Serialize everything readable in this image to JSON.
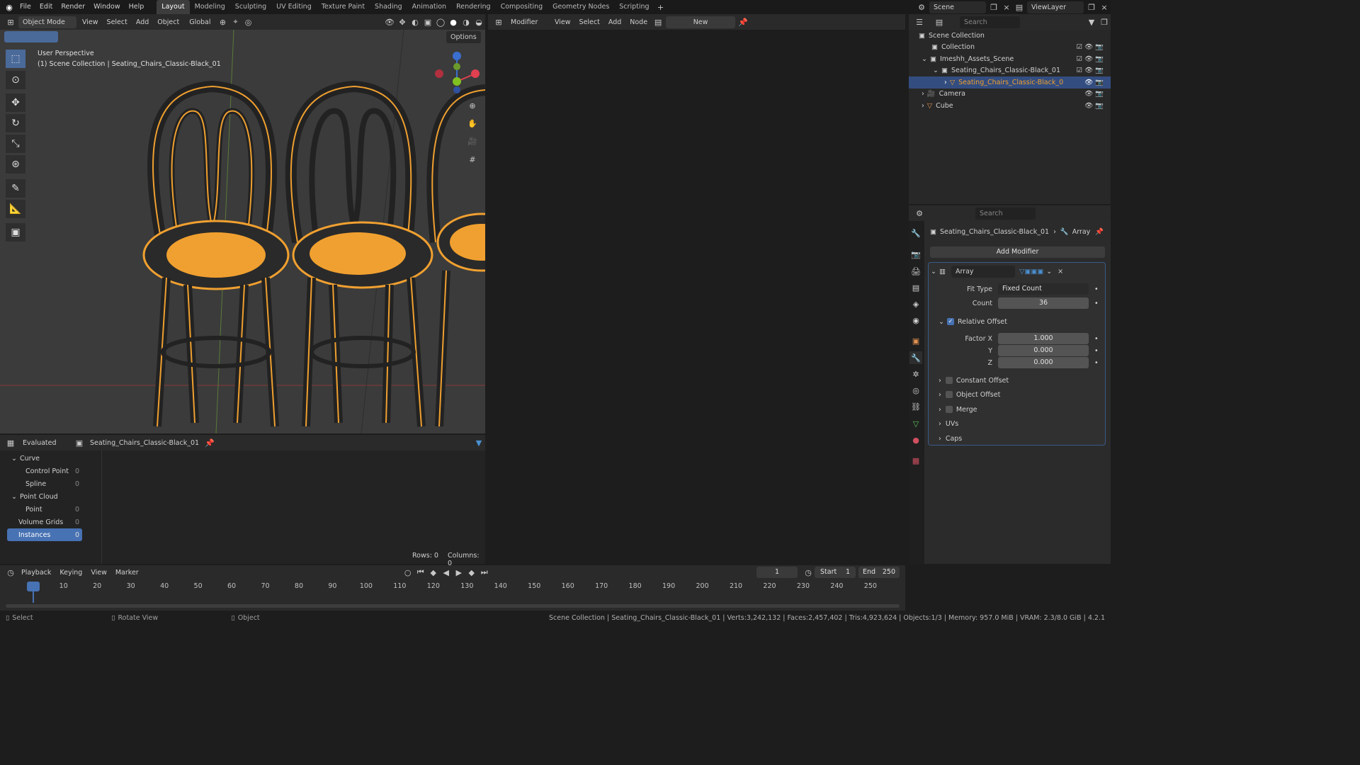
{
  "topbar": {
    "menus": [
      "File",
      "Edit",
      "Render",
      "Window",
      "Help"
    ],
    "workspaces": [
      "Layout",
      "Modeling",
      "Sculpting",
      "UV Editing",
      "Texture Paint",
      "Shading",
      "Animation",
      "Rendering",
      "Compositing",
      "Geometry Nodes",
      "Scripting"
    ],
    "active_workspace": "Layout",
    "scene": "Scene",
    "viewlayer": "ViewLayer"
  },
  "viewport_header": {
    "mode": "Object Mode",
    "menus": [
      "View",
      "Select",
      "Add",
      "Object"
    ],
    "orientation": "Global",
    "options": "Options"
  },
  "viewport": {
    "perspective": "User Perspective",
    "context": "(1) Scene Collection | Seating_Chairs_Classic-Black_01"
  },
  "node_editor": {
    "type": "Modifier",
    "menus": [
      "View",
      "Select",
      "Add",
      "Node"
    ],
    "new_label": "New"
  },
  "spreadsheet": {
    "mode": "Evaluated",
    "object": "Seating_Chairs_Classic-Black_01",
    "rows_label": "Rows: 0",
    "columns_label": "Columns: 0",
    "tree": [
      {
        "label": "Curve",
        "count": ""
      },
      {
        "label": "Control Point",
        "count": "0"
      },
      {
        "label": "Spline",
        "count": "0"
      },
      {
        "label": "Point Cloud",
        "count": ""
      },
      {
        "label": "Point",
        "count": "0"
      },
      {
        "label": "Volume Grids",
        "count": "0"
      },
      {
        "label": "Instances",
        "count": "0"
      }
    ]
  },
  "outliner": {
    "search_placeholder": "Search",
    "items": [
      "Scene Collection",
      "Collection",
      "Imeshh_Assets_Scene",
      "Seating_Chairs_Classic-Black_01",
      "Seating_Chairs_Classic-Black_0",
      "Camera",
      "Cube"
    ]
  },
  "properties": {
    "search_placeholder": "Search",
    "breadcrumb_object": "Seating_Chairs_Classic-Black_01",
    "breadcrumb_modifier": "Array",
    "add_modifier": "Add Modifier",
    "modifier_name": "Array",
    "fit_type_label": "Fit Type",
    "fit_type": "Fixed Count",
    "count_label": "Count",
    "count": "36",
    "relative_offset": "Relative Offset",
    "factor_x_label": "Factor X",
    "factor_x": "1.000",
    "y_label": "Y",
    "y": "0.000",
    "z_label": "Z",
    "z": "0.000",
    "sections": [
      "Constant Offset",
      "Object Offset",
      "Merge",
      "UVs",
      "Caps"
    ]
  },
  "timeline": {
    "menus": [
      "Playback",
      "Keying",
      "View",
      "Marker"
    ],
    "current_frame": "1",
    "start_label": "Start",
    "start": "1",
    "end_label": "End",
    "end": "250",
    "ticks": [
      "1",
      "10",
      "20",
      "30",
      "40",
      "50",
      "60",
      "70",
      "80",
      "90",
      "100",
      "110",
      "120",
      "130",
      "140",
      "150",
      "160",
      "170",
      "180",
      "190",
      "200",
      "210",
      "220",
      "230",
      "240",
      "250"
    ]
  },
  "status": {
    "select": "Select",
    "rotate": "Rotate View",
    "object": "Object",
    "info": "Scene Collection | Seating_Chairs_Classic-Black_01 | Verts:3,242,132 | Faces:2,457,402 | Tris:4,923,624 | Objects:1/3 | Memory: 957.0 MiB | VRAM: 2.3/8.0 GiB | 4.2.1"
  },
  "colors": {
    "accent": "#4772b3",
    "selection": "#f0a030",
    "viewport_bg": "#3b3b3b"
  }
}
